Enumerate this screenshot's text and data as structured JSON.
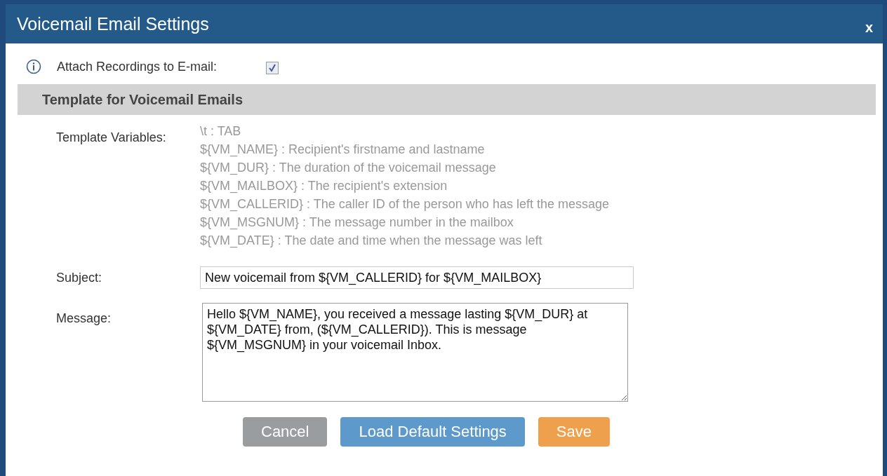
{
  "dialog": {
    "title": "Voicemail Email Settings",
    "close": "x"
  },
  "attach_recordings": {
    "label": "Attach Recordings to E-mail:",
    "checked": true
  },
  "section": {
    "title": "Template for Voicemail Emails"
  },
  "template_variables": {
    "label": "Template Variables:",
    "items": [
      "\\t : TAB",
      "${VM_NAME} : Recipient's firstname and lastname",
      "${VM_DUR} : The duration of the voicemail message",
      "${VM_MAILBOX} : The recipient's extension",
      "${VM_CALLERID} : The caller ID of the person who has left the message",
      "${VM_MSGNUM} : The message number in the mailbox",
      "${VM_DATE} : The date and time when the message was left"
    ]
  },
  "subject": {
    "label": "Subject:",
    "value": "New voicemail from ${VM_CALLERID} for ${VM_MAILBOX}"
  },
  "message": {
    "label": "Message:",
    "value": "Hello ${VM_NAME}, you received a message lasting ${VM_DUR} at ${VM_DATE} from, (${VM_CALLERID}). This is message ${VM_MSGNUM} in your voicemail Inbox."
  },
  "buttons": [
    {
      "label": "Cancel",
      "kind": "cancel"
    },
    {
      "label": "Load Default Settings",
      "kind": "default"
    },
    {
      "label": "Save",
      "kind": "save"
    }
  ]
}
